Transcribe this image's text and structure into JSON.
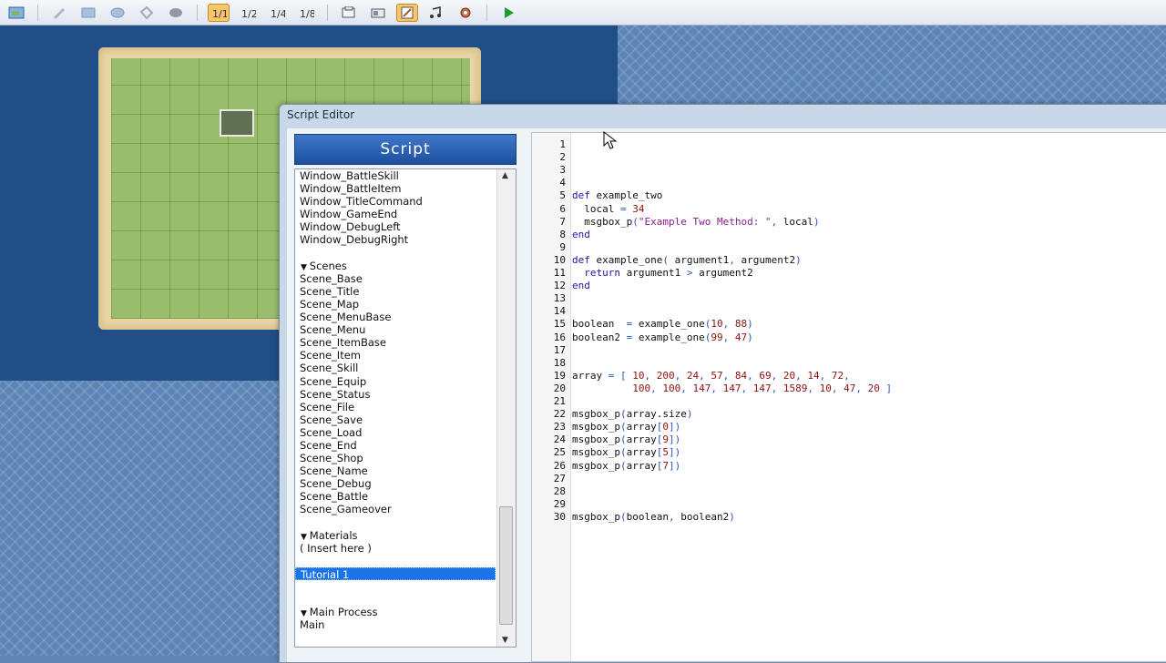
{
  "toolbar": {
    "icons": [
      "map-icon",
      "pencil-icon",
      "rectangle-icon",
      "ellipse-icon",
      "flood-fill-icon",
      "shadow-pen-icon",
      "zoom-1-1-icon",
      "zoom-1-2-icon",
      "zoom-1-4-icon",
      "zoom-1-8-icon",
      "database-icon",
      "resource-manager-icon",
      "script-editor-icon",
      "sound-test-icon",
      "settings-icon",
      "playtest-icon"
    ],
    "active": [
      "zoom-1-1-icon",
      "script-editor-icon"
    ],
    "accent_color": "#f6c56d"
  },
  "editor_window": {
    "title": "Script Editor"
  },
  "script_panel": {
    "header": "Script",
    "items_top": [
      "Window_BattleSkill",
      "Window_BattleItem",
      "Window_TitleCommand",
      "Window_GameEnd",
      "Window_DebugLeft",
      "Window_DebugRight"
    ],
    "sections": [
      {
        "label": "Scenes",
        "items": [
          "Scene_Base",
          "Scene_Title",
          "Scene_Map",
          "Scene_MenuBase",
          "Scene_Menu",
          "Scene_ItemBase",
          "Scene_Item",
          "Scene_Skill",
          "Scene_Equip",
          "Scene_Status",
          "Scene_File",
          "Scene_Save",
          "Scene_Load",
          "Scene_End",
          "Scene_Shop",
          "Scene_Name",
          "Scene_Debug",
          "Scene_Battle",
          "Scene_Gameover"
        ]
      },
      {
        "label": "Materials",
        "items": [
          "( Insert here )",
          "",
          "Tutorial 1",
          ""
        ]
      },
      {
        "label": "Main Process",
        "items": [
          "Main"
        ]
      }
    ],
    "selected_item": "Tutorial 1",
    "selection_color": "#1a73e8"
  },
  "code": {
    "line_numbers": [
      "1",
      "2",
      "3",
      "4",
      "5",
      "6",
      "7",
      "8",
      "9",
      "10",
      "11",
      "12",
      "13",
      "14",
      "15",
      "16",
      "17",
      "18",
      "19",
      "20",
      "21",
      "22",
      "23",
      "24",
      "25",
      "26",
      "27",
      "28",
      "29",
      "30"
    ],
    "lines": [
      "",
      "",
      "",
      "",
      "def example_two",
      "  local = 34",
      "  msgbox_p(\"Example Two Method: \", local)",
      "end",
      "",
      "def example_one( argument1, argument2)",
      "  return argument1 > argument2",
      "end",
      "",
      "",
      "boolean  = example_one(10, 88)",
      "boolean2 = example_one(99, 47)",
      "",
      "",
      "array = [ 10, 200, 24, 57, 84, 69, 20, 14, 72,",
      "          100, 100, 147, 147, 147, 1589, 10, 47, 20 ]",
      "",
      "msgbox_p(array.size)",
      "msgbox_p(array[0])",
      "msgbox_p(array[9])",
      "msgbox_p(array[5])",
      "msgbox_p(array[7])",
      "",
      "",
      "",
      "msgbox_p(boolean, boolean2)"
    ],
    "colors": {
      "keyword": "#1b18a8",
      "number": "#8e1010",
      "string": "#8a1f8f",
      "operator": "#2b57b7"
    }
  }
}
